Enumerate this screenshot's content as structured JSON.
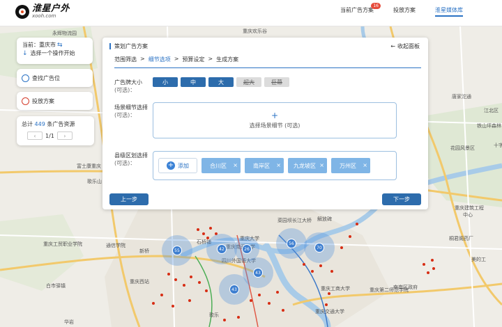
{
  "header": {
    "logo_name": "淮星户外",
    "logo_url": "xooh.com",
    "nav": [
      {
        "label": "当前广告方案",
        "badge": "16"
      },
      {
        "label": "投放方案"
      },
      {
        "label": "淮星媒体库"
      }
    ]
  },
  "sidebar": {
    "location_label": "当前：重庆市",
    "location_hint": "选择一个操作开始",
    "find_label": "查找广告位",
    "plan_label": "投放方案",
    "total_prefix": "总计",
    "total_count": "449",
    "total_suffix": "条广告资源",
    "page": "1/1"
  },
  "panel": {
    "title": "策划广告方案",
    "collapse": "收起面板",
    "steps": [
      "范围筛选",
      "细节选项",
      "预算设定",
      "生成方案"
    ],
    "active_step": 1,
    "size_label": "广告牌大小",
    "optional": "(可选)：",
    "sizes": [
      {
        "label": "小",
        "enabled": true
      },
      {
        "label": "中",
        "enabled": true
      },
      {
        "label": "大",
        "enabled": true
      },
      {
        "label": "超大",
        "enabled": false
      },
      {
        "label": "巨幕",
        "enabled": false
      }
    ],
    "scene_label": "场景细节选择",
    "scene_add": "选择场景细节 (可选)",
    "district_label": "县级区划选择",
    "add_label": "添加",
    "districts": [
      "合川区",
      "南岸区",
      "九龙坡区",
      "万州区"
    ],
    "prev": "上一步",
    "next": "下一步"
  },
  "map": {
    "labels": [
      "永辉物流园",
      "重庆欢乐谷",
      "解放碑",
      "唐家沱通",
      "江北区",
      "铁山坪森林",
      "花园风景区",
      "十字",
      "富士康重庆",
      "歌乐山",
      "重庆建筑工程",
      "中心",
      "桐君阁药厂",
      "美的工",
      "南岸区政府",
      "重庆第二师范学院",
      "重庆工商大学",
      "重庆交通大学",
      "重庆工贸职业学院",
      "通信学院",
      "新桥",
      "石桥铺",
      "歌乐",
      "白市驿镇",
      "重庆西站",
      "华岩",
      "重庆南开中学",
      "四川外国语大学",
      "菜园坝长江大桥",
      "重庆大学"
    ],
    "clusters": [
      "55",
      "42",
      "26",
      "43",
      "56",
      "70",
      "43"
    ]
  }
}
